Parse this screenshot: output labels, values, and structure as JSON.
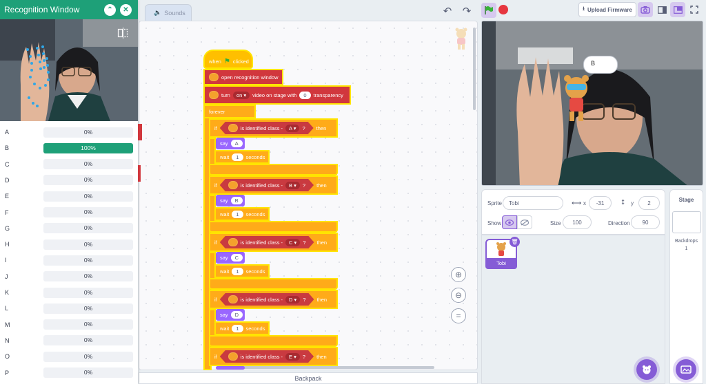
{
  "tabs": {
    "sounds": "Sounds"
  },
  "toolbar": {
    "upload_firmware": "Upload Firmware"
  },
  "recognition": {
    "title": "Recognition Window",
    "classes": [
      {
        "label": "A",
        "value": "0%",
        "fraction": 0
      },
      {
        "label": "B",
        "value": "100%",
        "fraction": 1
      },
      {
        "label": "C",
        "value": "0%",
        "fraction": 0
      },
      {
        "label": "D",
        "value": "0%",
        "fraction": 0
      },
      {
        "label": "E",
        "value": "0%",
        "fraction": 0
      },
      {
        "label": "F",
        "value": "0%",
        "fraction": 0
      },
      {
        "label": "G",
        "value": "0%",
        "fraction": 0
      },
      {
        "label": "H",
        "value": "0%",
        "fraction": 0
      },
      {
        "label": "I",
        "value": "0%",
        "fraction": 0
      },
      {
        "label": "J",
        "value": "0%",
        "fraction": 0
      },
      {
        "label": "K",
        "value": "0%",
        "fraction": 0
      },
      {
        "label": "L",
        "value": "0%",
        "fraction": 0
      },
      {
        "label": "M",
        "value": "0%",
        "fraction": 0
      },
      {
        "label": "N",
        "value": "0%",
        "fraction": 0
      },
      {
        "label": "O",
        "value": "0%",
        "fraction": 0
      },
      {
        "label": "P",
        "value": "0%",
        "fraction": 0
      }
    ]
  },
  "blocks": {
    "when": "when",
    "clicked": "clicked",
    "open_recognition": "open recognition window",
    "turn": "turn",
    "on": "on",
    "video_on_stage": "video on stage with",
    "transparency_value": "0",
    "transparency": "transparency",
    "forever": "forever",
    "if": "if",
    "is_identified": "is identified class -",
    "q": "?",
    "then": "then",
    "say": "say",
    "wait": "wait",
    "wait_value": "1",
    "seconds": "seconds",
    "classes": [
      "A",
      "B",
      "C",
      "D",
      "E"
    ]
  },
  "backpack": "Backpack",
  "stage": {
    "bubble": "B"
  },
  "sprite": {
    "label": "Sprite",
    "name": "Tobi",
    "x_label": "x",
    "x": "-31",
    "y_label": "y",
    "y": "2",
    "show_label": "Show",
    "size_label": "Size",
    "size": "100",
    "direction_label": "Direction",
    "direction": "90",
    "thumb_name": "Tobi"
  },
  "stage_panel": {
    "title": "Stage",
    "backdrops_label": "Backdrops",
    "backdrops_count": "1"
  },
  "colors": {
    "accent": "#1ea078",
    "purple": "#855cd6",
    "extension": "#d1373d",
    "control": "#ffab19"
  }
}
